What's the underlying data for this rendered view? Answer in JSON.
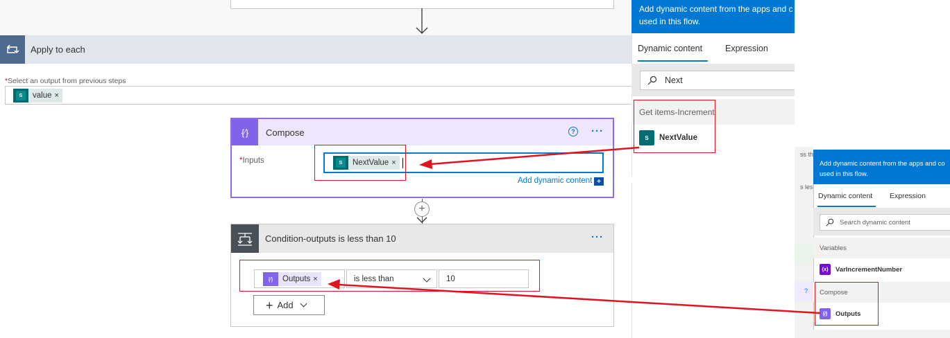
{
  "apply_to_each": {
    "title": "Apply to each",
    "required_label": "Select an output from previous steps",
    "token": {
      "label": "value",
      "remove": "×"
    }
  },
  "compose": {
    "title": "Compose",
    "inputs_label": "Inputs",
    "token": {
      "label": "NextValue",
      "remove": "×"
    },
    "add_dynamic_label": "Add dynamic content",
    "help": "?",
    "more": "···"
  },
  "condition": {
    "title": "Condition-outputs is less than 10",
    "left_token": {
      "label": "Outputs",
      "remove": "×"
    },
    "operator": "is less than",
    "value": "10",
    "add_button": "Add",
    "more": "···"
  },
  "dynamic_panel_main": {
    "banner_line1": "Add dynamic content from the apps and c",
    "banner_line2": "used in this flow.",
    "tab_dynamic": "Dynamic content",
    "tab_expression": "Expression",
    "search_value": "Next",
    "group_label": "Get items-Increment",
    "item_label": "NextValue"
  },
  "dynamic_panel_secondary": {
    "banner_line1": "Add dynamic content from the apps and co",
    "banner_line2": "used in this flow.",
    "tab_dynamic": "Dynamic content",
    "tab_expression": "Expression",
    "search_placeholder": "Search dynamic content",
    "group_variables": "Variables",
    "variable_item": "VarIncrementNumber",
    "group_compose": "Compose",
    "compose_item": "Outputs",
    "sliver_text1": "ss th",
    "sliver_text2": "s les"
  },
  "colors": {
    "accent": "#0078d4",
    "compose_purple": "#8063e8",
    "sharepoint_teal": "#036c70",
    "annotation_red": "#e0141e"
  }
}
